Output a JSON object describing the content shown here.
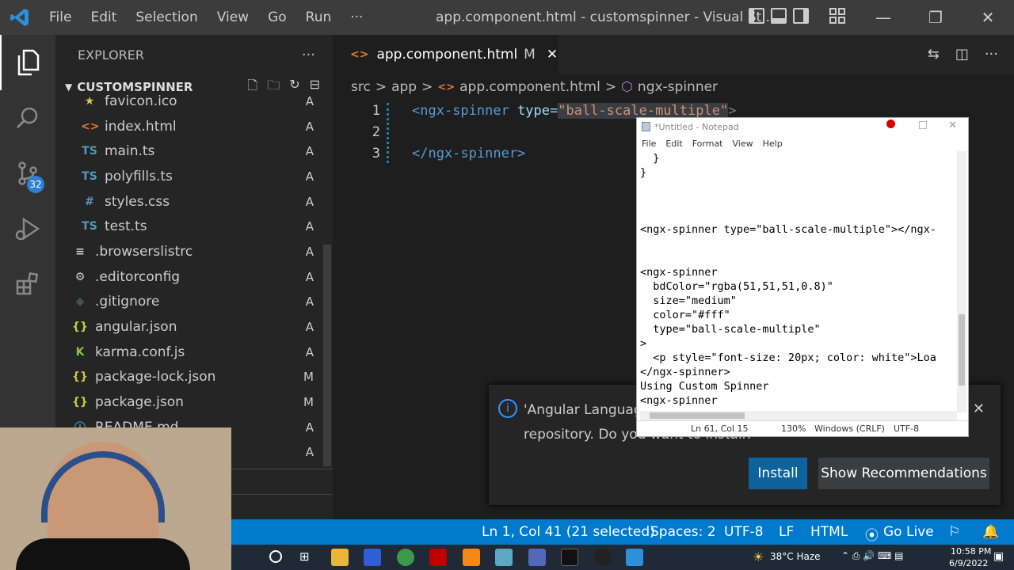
{
  "titlebar": {
    "menu": [
      "File",
      "Edit",
      "Selection",
      "View",
      "Go",
      "Run",
      "···"
    ],
    "title": "app.component.html - customspinner - Visual St...",
    "controls": [
      "—",
      "❐",
      "✕"
    ]
  },
  "activity": {
    "scm_badge": "32"
  },
  "sidebar": {
    "header": "EXPLORER",
    "header_more": "···",
    "section": "CUSTOMSPINNER",
    "files": [
      {
        "icon": "★",
        "name": "favicon.ico",
        "status": "A",
        "indent": 1,
        "color": "#e8c33c"
      },
      {
        "icon": "<>",
        "name": "index.html",
        "status": "A",
        "indent": 1,
        "color": "#e37933"
      },
      {
        "icon": "TS",
        "name": "main.ts",
        "status": "A",
        "indent": 1,
        "color": "#519aba"
      },
      {
        "icon": "TS",
        "name": "polyfills.ts",
        "status": "A",
        "indent": 1,
        "color": "#519aba"
      },
      {
        "icon": "#",
        "name": "styles.css",
        "status": "A",
        "indent": 1,
        "color": "#519aba"
      },
      {
        "icon": "TS",
        "name": "test.ts",
        "status": "A",
        "indent": 1,
        "color": "#519aba"
      },
      {
        "icon": "≡",
        "name": ".browserslistrc",
        "status": "A",
        "indent": 0,
        "color": "#ccc"
      },
      {
        "icon": "⚙",
        "name": ".editorconfig",
        "status": "A",
        "indent": 0,
        "color": "#ccc"
      },
      {
        "icon": "◆",
        "name": ".gitignore",
        "status": "A",
        "indent": 0,
        "color": "#41535b"
      },
      {
        "icon": "{}",
        "name": "angular.json",
        "status": "A",
        "indent": 0,
        "color": "#cbcb41"
      },
      {
        "icon": "K",
        "name": "karma.conf.js",
        "status": "A",
        "indent": 0,
        "color": "#8dc149"
      },
      {
        "icon": "{}",
        "name": "package-lock.json",
        "status": "M",
        "indent": 0,
        "color": "#cbcb41"
      },
      {
        "icon": "{}",
        "name": "package.json",
        "status": "M",
        "indent": 0,
        "color": "#cbcb41"
      },
      {
        "icon": "ⓘ",
        "name": "README.md",
        "status": "A",
        "indent": 0,
        "color": "#519aba"
      },
      {
        "icon": "",
        "name": "",
        "status": "A",
        "indent": 0,
        "color": "#ccc"
      }
    ]
  },
  "editor": {
    "tab_label": "app.component.html",
    "tab_status": "M",
    "tab_close": "✕",
    "breadcrumb": [
      "src",
      ">",
      "app",
      ">",
      "app.component.html",
      ">",
      "ngx-spinner"
    ],
    "lines": [
      {
        "n": "1",
        "tag_open": "<ngx-spinner",
        "attr": " type=",
        "val": "\"ball-scale-multiple\"",
        "tag_close": ">"
      },
      {
        "n": "2"
      },
      {
        "n": "3",
        "tag_end": "</ngx-spinner>"
      }
    ]
  },
  "notepad": {
    "title": "*Untitled - Notepad",
    "menu": [
      "File",
      "Edit",
      "Format",
      "View",
      "Help"
    ],
    "text": "  }\n}\n\n\n\n<ngx-spinner type=\"ball-scale-multiple\"></ngx-\n\n\n<ngx-spinner\n  bdColor=\"rgba(51,51,51,0.8)\"\n  size=\"medium\"\n  color=\"#fff\"\n  type=\"ball-scale-multiple\"\n>\n  <p style=\"font-size: 20px; color: white\">Loa\n</ngx-spinner>\nUsing Custom Spinner\n<ngx-spinner",
    "status_pos": "Ln 61, Col 15",
    "status_zoom": "130%",
    "status_eol": "Windows (CRLF)",
    "status_enc": "UTF-8"
  },
  "notification": {
    "line1": "'Angular Languag",
    "line2": "repository. Do you want to install?",
    "install": "Install",
    "show": "Show Recommendations",
    "close": "✕"
  },
  "statusbar": {
    "position": "Ln 1, Col 41 (21 selected)",
    "spaces": "Spaces: 2",
    "encoding": "UTF-8",
    "eol": "LF",
    "language": "HTML",
    "golive": "Go Live"
  },
  "taskbar": {
    "weather": "38°C  Haze",
    "time": "10:58 PM",
    "date": "6/9/2022"
  }
}
